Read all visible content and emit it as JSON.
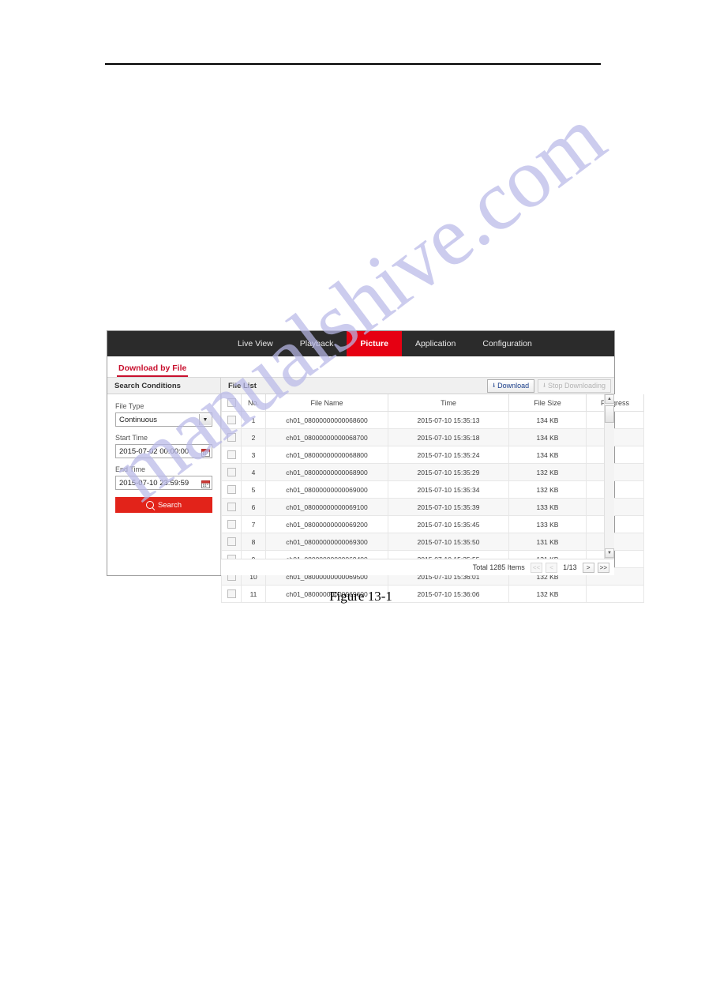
{
  "document": {
    "figure_caption": "Figure 13-1",
    "watermark": "manualshive.com"
  },
  "nav": {
    "tabs": [
      {
        "label": "Live View",
        "active": false
      },
      {
        "label": "Playback",
        "active": false
      },
      {
        "label": "Picture",
        "active": true
      },
      {
        "label": "Application",
        "active": false
      },
      {
        "label": "Configuration",
        "active": false
      }
    ]
  },
  "subtab": {
    "label": "Download by File"
  },
  "sidebar": {
    "title": "Search Conditions",
    "file_type_label": "File Type",
    "file_type_value": "Continuous",
    "file_type_options": [
      "Continuous"
    ],
    "start_time_label": "Start Time",
    "start_time_value": "2015-07-02 00:00:00",
    "end_time_label": "End Time",
    "end_time_value": "2015-07-10 23:59:59",
    "search_label": "Search"
  },
  "filelist": {
    "title": "File List",
    "download_label": "Download",
    "stop_label": "Stop Downloading",
    "stop_disabled": true,
    "columns": [
      "",
      "No.",
      "File Name",
      "Time",
      "File Size",
      "Progress",
      ""
    ],
    "rows": [
      {
        "no": "1",
        "name": "ch01_08000000000068600",
        "time": "2015-07-10 15:35:13",
        "size": "134 KB",
        "progress": ""
      },
      {
        "no": "2",
        "name": "ch01_08000000000068700",
        "time": "2015-07-10 15:35:18",
        "size": "134 KB",
        "progress": ""
      },
      {
        "no": "3",
        "name": "ch01_08000000000068800",
        "time": "2015-07-10 15:35:24",
        "size": "134 KB",
        "progress": ""
      },
      {
        "no": "4",
        "name": "ch01_08000000000068900",
        "time": "2015-07-10 15:35:29",
        "size": "132 KB",
        "progress": ""
      },
      {
        "no": "5",
        "name": "ch01_08000000000069000",
        "time": "2015-07-10 15:35:34",
        "size": "132 KB",
        "progress": ""
      },
      {
        "no": "6",
        "name": "ch01_08000000000069100",
        "time": "2015-07-10 15:35:39",
        "size": "133 KB",
        "progress": ""
      },
      {
        "no": "7",
        "name": "ch01_08000000000069200",
        "time": "2015-07-10 15:35:45",
        "size": "133 KB",
        "progress": ""
      },
      {
        "no": "8",
        "name": "ch01_08000000000069300",
        "time": "2015-07-10 15:35:50",
        "size": "131 KB",
        "progress": ""
      },
      {
        "no": "9",
        "name": "ch01_08000000000069400",
        "time": "2015-07-10 15:35:55",
        "size": "131 KB",
        "progress": ""
      },
      {
        "no": "10",
        "name": "ch01_08000000000069500",
        "time": "2015-07-10 15:36:01",
        "size": "132 KB",
        "progress": ""
      },
      {
        "no": "11",
        "name": "ch01_08000000000069600",
        "time": "2015-07-10 15:36:06",
        "size": "132 KB",
        "progress": ""
      }
    ],
    "footer": {
      "total_text": "Total 1285 Items",
      "first_label": "<<",
      "prev_label": "<",
      "page_label": "1/13",
      "next_label": ">",
      "last_label": ">>",
      "first_disabled": true,
      "prev_disabled": true
    }
  },
  "colors": {
    "accent_red": "#e60012",
    "navbar_bg": "#2b2b2b",
    "subtab_red": "#c8102e",
    "search_btn": "#e2231a",
    "watermark": "#b9b9e8"
  }
}
